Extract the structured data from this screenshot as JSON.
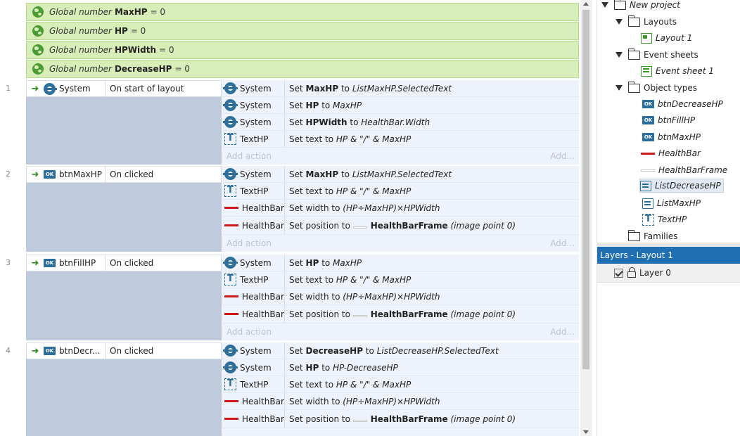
{
  "globals": [
    {
      "kw": "Global number",
      "name": "MaxHP",
      "value": "= 0"
    },
    {
      "kw": "Global number",
      "name": "HP",
      "value": "= 0"
    },
    {
      "kw": "Global number",
      "name": "HPWidth",
      "value": "= 0"
    },
    {
      "kw": "Global number",
      "name": "DecreaseHP",
      "value": "= 0"
    }
  ],
  "add_action_label": "Add action",
  "add_label": "Add...",
  "events": [
    {
      "num": "1",
      "cond_obj": "System",
      "cond_icon": "gear-icon",
      "cond_text": "On start of layout",
      "actions": [
        {
          "obj": "System",
          "icon": "gear-icon",
          "pre": "Set ",
          "b": "MaxHP",
          "mid": " to ",
          "i": "ListMaxHP.SelectedText",
          "b2": "",
          "i2": ""
        },
        {
          "obj": "System",
          "icon": "gear-icon",
          "pre": "Set ",
          "b": "HP",
          "mid": " to ",
          "i": "MaxHP",
          "b2": "",
          "i2": ""
        },
        {
          "obj": "System",
          "icon": "gear-icon",
          "pre": "Set ",
          "b": "HPWidth",
          "mid": " to ",
          "i": "HealthBar.Width",
          "b2": "",
          "i2": ""
        },
        {
          "obj": "TextHP",
          "icon": "text-icon",
          "pre": "Set text to ",
          "b": "",
          "mid": "",
          "i": "HP & \"/\" & MaxHP",
          "b2": "",
          "i2": ""
        }
      ]
    },
    {
      "num": "2",
      "cond_obj": "btnMaxHP",
      "cond_icon": "button-icon",
      "cond_text": "On clicked",
      "actions": [
        {
          "obj": "System",
          "icon": "gear-icon",
          "pre": "Set ",
          "b": "MaxHP",
          "mid": " to ",
          "i": "ListMaxHP.SelectedText",
          "b2": "",
          "i2": ""
        },
        {
          "obj": "TextHP",
          "icon": "text-icon",
          "pre": "Set text to ",
          "b": "",
          "mid": "",
          "i": "HP & \"/\" & MaxHP",
          "b2": "",
          "i2": ""
        },
        {
          "obj": "HealthBar",
          "icon": "healthbar-icon",
          "pre": "Set width to ",
          "b": "",
          "mid": "",
          "i": "(HP÷MaxHP)×HPWidth",
          "b2": "",
          "i2": ""
        },
        {
          "obj": "HealthBar",
          "icon": "healthbar-icon",
          "pre": "Set position to ",
          "b": "",
          "mid": "",
          "i": "",
          "b2": "HealthBarFrame",
          "i2": "(image point 0)"
        }
      ]
    },
    {
      "num": "3",
      "cond_obj": "btnFillHP",
      "cond_icon": "button-icon",
      "cond_text": "On clicked",
      "actions": [
        {
          "obj": "System",
          "icon": "gear-icon",
          "pre": "Set ",
          "b": "HP",
          "mid": " to ",
          "i": "MaxHP",
          "b2": "",
          "i2": ""
        },
        {
          "obj": "TextHP",
          "icon": "text-icon",
          "pre": "Set text to ",
          "b": "",
          "mid": "",
          "i": "HP & \"/\" & MaxHP",
          "b2": "",
          "i2": ""
        },
        {
          "obj": "HealthBar",
          "icon": "healthbar-icon",
          "pre": "Set width to ",
          "b": "",
          "mid": "",
          "i": "(HP÷MaxHP)×HPWidth",
          "b2": "",
          "i2": ""
        },
        {
          "obj": "HealthBar",
          "icon": "healthbar-icon",
          "pre": "Set position to ",
          "b": "",
          "mid": "",
          "i": "",
          "b2": "HealthBarFrame",
          "i2": "(image point 0)"
        }
      ]
    },
    {
      "num": "4",
      "cond_obj": "btnDecr...",
      "cond_icon": "button-icon",
      "cond_text": "On clicked",
      "actions": [
        {
          "obj": "System",
          "icon": "gear-icon",
          "pre": "Set ",
          "b": "DecreaseHP",
          "mid": " to ",
          "i": "ListDecreaseHP.SelectedText",
          "b2": "",
          "i2": ""
        },
        {
          "obj": "System",
          "icon": "gear-icon",
          "pre": "Set ",
          "b": "HP",
          "mid": " to ",
          "i": "HP-DecreaseHP",
          "b2": "",
          "i2": ""
        },
        {
          "obj": "TextHP",
          "icon": "text-icon",
          "pre": "Set text to ",
          "b": "",
          "mid": "",
          "i": "HP & \"/\" & MaxHP",
          "b2": "",
          "i2": ""
        },
        {
          "obj": "HealthBar",
          "icon": "healthbar-icon",
          "pre": "Set width to ",
          "b": "",
          "mid": "",
          "i": "(HP÷MaxHP)×HPWidth",
          "b2": "",
          "i2": ""
        },
        {
          "obj": "HealthBar",
          "icon": "healthbar-icon",
          "pre": "Set position to ",
          "b": "",
          "mid": "",
          "i": "",
          "b2": "HealthBarFrame",
          "i2": "(image point 0)"
        }
      ]
    }
  ],
  "project": {
    "root": "New project",
    "layouts": "Layouts",
    "layout_1": "Layout 1",
    "event_sheets": "Event sheets",
    "event_sheet_1": "Event sheet 1",
    "object_types": "Object types",
    "objects": [
      {
        "name": "btnDecreaseHP",
        "icon": "button-icon"
      },
      {
        "name": "btnFillHP",
        "icon": "button-icon"
      },
      {
        "name": "btnMaxHP",
        "icon": "button-icon"
      },
      {
        "name": "HealthBar",
        "icon": "healthbar-icon"
      },
      {
        "name": "HealthBarFrame",
        "icon": "frame-icon"
      },
      {
        "name": "ListDecreaseHP",
        "icon": "list-icon"
      },
      {
        "name": "ListMaxHP",
        "icon": "list-icon"
      },
      {
        "name": "TextHP",
        "icon": "text-icon"
      }
    ],
    "families": "Families"
  },
  "layers": {
    "title": "Layers - Layout 1",
    "items": [
      {
        "name": "Layer 0"
      }
    ]
  },
  "button_icon_glyph": "OK",
  "colors": {
    "global_bg": "#d8eeb9",
    "condition_bg": "#bfcadc",
    "action_bg": "#eef3fb",
    "layers_header": "#1f6fb2",
    "healthbar": "#d01818"
  }
}
